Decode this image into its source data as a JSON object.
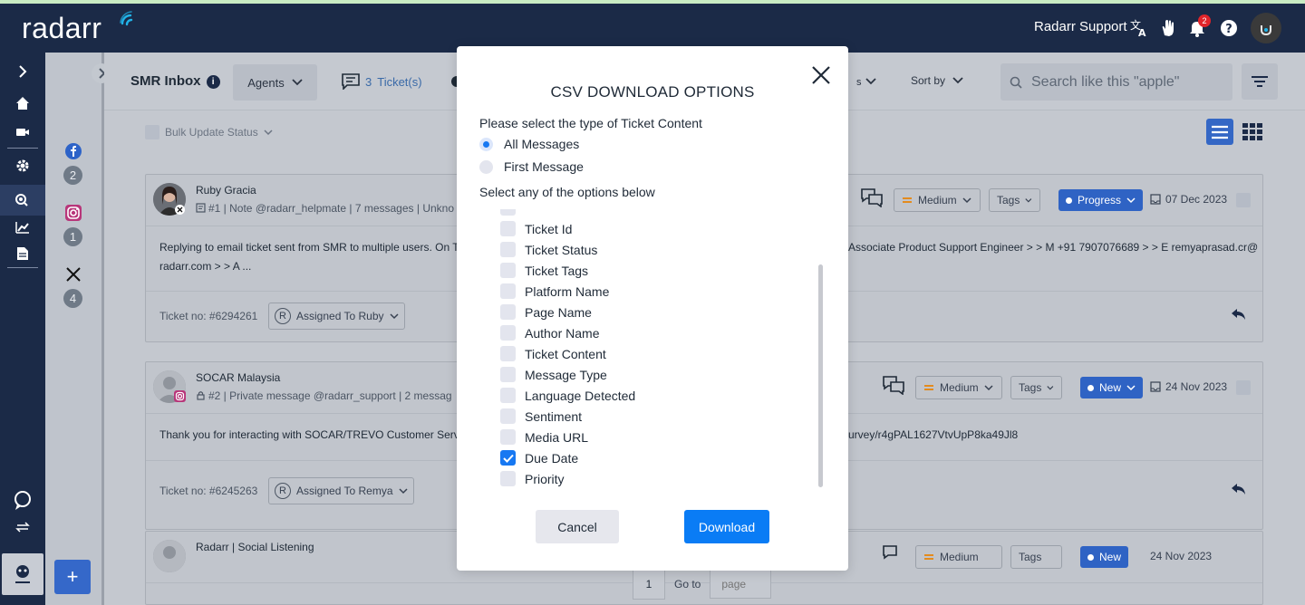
{
  "header": {
    "logo_text": "radarr",
    "user_name": "Radarr Support",
    "notification_count": "2"
  },
  "toolbar": {
    "title": "SMR Inbox",
    "agents_label": "Agents",
    "tickets_count": "3",
    "tickets_label": "Ticket(s)",
    "sort_label": "Sort by",
    "search_placeholder": "Search like this \"apple\"",
    "bulk_label": "Bulk Update Status"
  },
  "channels": [
    {
      "icon": "facebook-icon",
      "count": "2"
    },
    {
      "icon": "instagram-icon",
      "count": "1"
    },
    {
      "icon": "x-icon",
      "count": "4"
    }
  ],
  "tickets": [
    {
      "name": "Ruby Gracia",
      "meta": "#1 | Note @radarr_helpmate  | 7 messages  | Unkno",
      "body_line1": "Replying to email ticket sent from SMR to multiple users. On T",
      "body_line1_right": "Associate Product Support Engineer > > M +91 7907076689 > > E remyaprasad.cr@",
      "body_line2": "radarr.com > > A ...",
      "priority": "Medium",
      "tags": "Tags",
      "status": "Progress",
      "date": "07 Dec 2023",
      "ticket_no": "Ticket no: #6294261",
      "assigned": "Assigned To Ruby"
    },
    {
      "name": "SOCAR Malaysia",
      "meta": "#2 | Private message @radarr_support  | 2 messag",
      "body_line1": "Thank you for interacting with SOCAR/TREVO Customer Servic",
      "body_line1_right": "urvey/r4gPAL1627VtvUpP8ka49Jl8",
      "priority": "Medium",
      "tags": "Tags",
      "status": "New",
      "date": "24 Nov 2023",
      "ticket_no": "Ticket no: #6245263",
      "assigned": "Assigned To Remya"
    },
    {
      "name": "Radarr | Social Listening",
      "priority": "Medium",
      "tags": "Tags",
      "status": "New",
      "date": "24 Nov 2023"
    }
  ],
  "pager": {
    "page": "1",
    "goto_label": "Go to",
    "input_placeholder": "page"
  },
  "modal": {
    "title": "CSV DOWNLOAD OPTIONS",
    "content_type_label": "Please select the type of Ticket Content",
    "radio_options": [
      {
        "label": "All Messages",
        "selected": true
      },
      {
        "label": "First Message",
        "selected": false
      }
    ],
    "options_label": "Select any of the options below",
    "options": [
      {
        "label": "Ticket Id",
        "checked": false
      },
      {
        "label": "Ticket Status",
        "checked": false
      },
      {
        "label": "Ticket Tags",
        "checked": false
      },
      {
        "label": "Platform Name",
        "checked": false
      },
      {
        "label": "Page Name",
        "checked": false
      },
      {
        "label": "Author Name",
        "checked": false
      },
      {
        "label": "Ticket Content",
        "checked": false
      },
      {
        "label": "Message Type",
        "checked": false
      },
      {
        "label": "Language Detected",
        "checked": false
      },
      {
        "label": "Sentiment",
        "checked": false
      },
      {
        "label": "Media URL",
        "checked": false
      },
      {
        "label": "Due Date",
        "checked": true
      },
      {
        "label": "Priority",
        "checked": false
      }
    ],
    "cancel_label": "Cancel",
    "download_label": "Download"
  },
  "colors": {
    "header_bg": "#1b2a47",
    "accent": "#1778f2",
    "status_blue": "#2f63c4"
  }
}
